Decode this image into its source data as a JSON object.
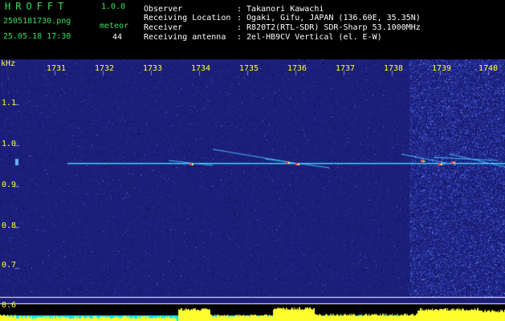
{
  "app": {
    "title": "HROFFT",
    "version": "1.0.0"
  },
  "file": {
    "name": "2505181730.png",
    "datetime": "25.05.18 17:30"
  },
  "meteor": {
    "label": "meteor",
    "count": "44"
  },
  "info": [
    {
      "label": "Observer",
      "value": ": Takanori Kawachi"
    },
    {
      "label": "Receiving Location",
      "value": ": Ogaki, Gifu, JAPAN (136.60E, 35.35N)"
    },
    {
      "label": "Receiver",
      "value": ": R820T2(RTL-SDR) SDR-Sharp 53.1000MHz"
    },
    {
      "label": "Receiving antenna",
      "value": ": 2el-HB9CV Vertical (el. E-W)"
    }
  ],
  "axes": {
    "unit": "kHz",
    "x_ticks": [
      "1731",
      "1732",
      "1733",
      "1734",
      "1735",
      "1736",
      "1737",
      "1738",
      "1739",
      "1740"
    ],
    "y_ticks": [
      "1.1",
      "1.0",
      "0.9",
      "0.8",
      "0.7",
      "0.6"
    ]
  },
  "colors": {
    "background": "#1b1f7a",
    "header_text": "#36e05a",
    "tick_text": "#ffff30",
    "signal_line": "#4fd8ff",
    "level_fill": "#ffff30",
    "level_base": "#00e0ff"
  }
}
